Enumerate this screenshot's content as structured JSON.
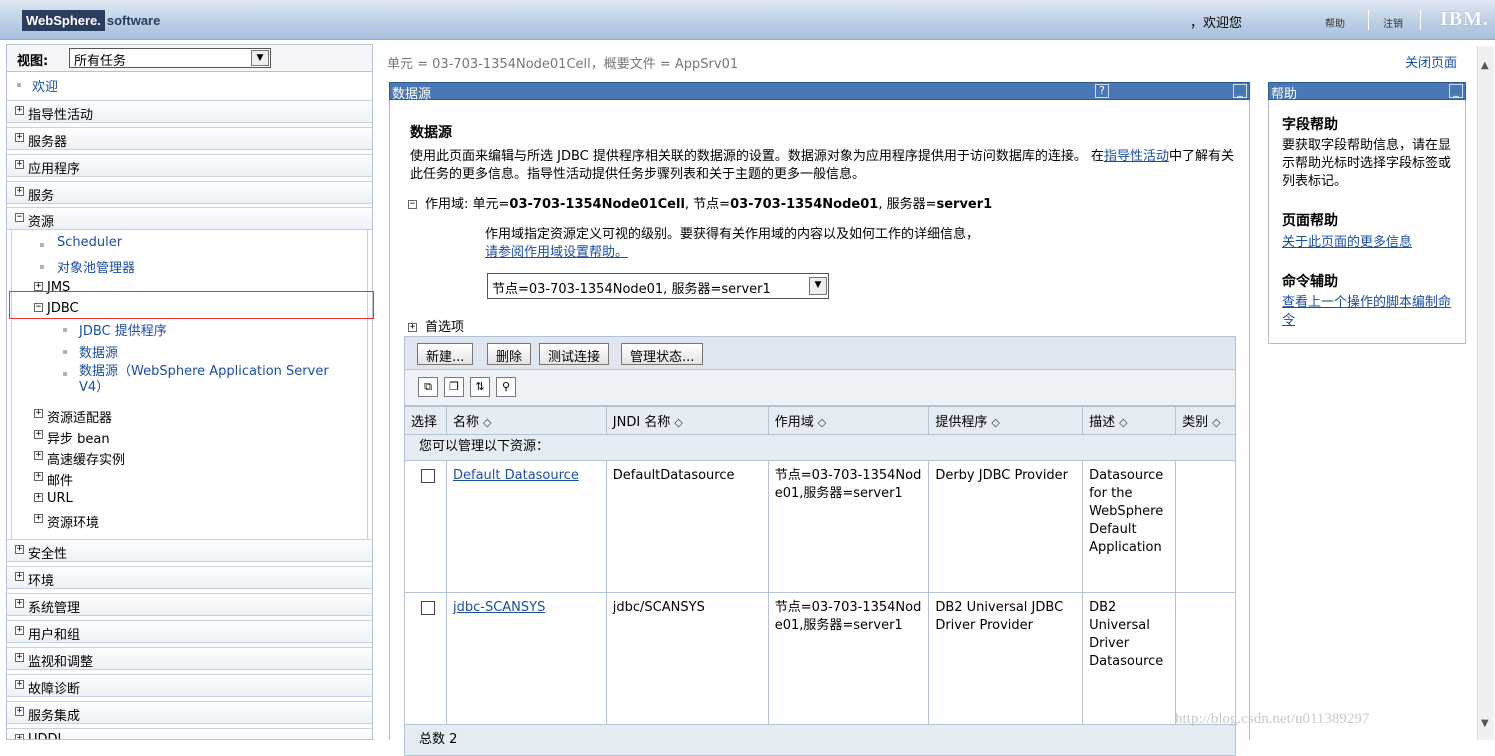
{
  "banner": {
    "logo_brand": "WebSphere.",
    "logo_product": "software",
    "welcome": "，欢迎您",
    "help": "帮助",
    "logout": "注销",
    "ibm": "IBM."
  },
  "nav": {
    "view_label": "视图:",
    "view_value": "所有任务",
    "welcome_item": "欢迎",
    "top_items": [
      "指导性活动",
      "服务器",
      "应用程序",
      "服务",
      "资源"
    ],
    "resources": {
      "scheduler": "Scheduler",
      "object_pool": "对象池管理器",
      "jms": "JMS",
      "jdbc": "JDBC",
      "jdbc_provider": "JDBC 提供程序",
      "datasource": "数据源",
      "datasource_v4": "数据源（WebSphere Application Server V4）",
      "sub_items": [
        "资源适配器",
        "异步 bean",
        "高速缓存实例",
        "邮件",
        "URL",
        "资源环境"
      ]
    },
    "bottom_items": [
      "安全性",
      "环境",
      "系统管理",
      "用户和组",
      "监视和调整",
      "故障诊断",
      "服务集成",
      "UDDI"
    ]
  },
  "breadcrumb": "单元 = 03-703-1354Node01Cell，概要文件 = AppSrv01",
  "close_page": "关闭页面",
  "main_panel": {
    "title_bar": "数据源",
    "help_btn": "?",
    "min_btn": "_",
    "heading": "数据源",
    "desc_1": "使用此页面来编辑与所选 JDBC 提供程序相关联的数据源的设置。数据源对象为应用程序提供用于访问数据库的连接。 在",
    "desc_link": "指导性活动",
    "desc_2": "中了解有关此任务的更多信息。指导性活动提供任务步骤列表和关于主题的更多一般信息。",
    "scope_prefix": "作用域: 单元=",
    "scope_cell": "03-703-1354Node01Cell",
    "scope_mid1": ", 节点=",
    "scope_node": "03-703-1354Node01",
    "scope_mid2": ", 服务器=",
    "scope_server": "server1",
    "scope_desc": "作用域指定资源定义可视的级别。要获得有关作用域的内容以及如何工作的详细信息，",
    "scope_help_link": "请参阅作用域设置帮助。",
    "scope_select": "节点=03-703-1354Node01, 服务器=server1",
    "preferences": "首选项",
    "buttons": [
      "新建...",
      "删除",
      "测试连接",
      "管理状态..."
    ],
    "table": {
      "headers": [
        "选择",
        "名称",
        "JNDI 名称",
        "作用域",
        "提供程序",
        "描述",
        "类别"
      ],
      "manage_text": "您可以管理以下资源：",
      "rows": [
        {
          "name": "Default Datasource",
          "jndi": "DefaultDatasource",
          "scope": "节点=03-703-1354Node01,服务器=server1",
          "provider": "Derby JDBC Provider",
          "desc": "Datasource for the WebSphere Default Application",
          "category": ""
        },
        {
          "name": "jdbc-SCANSYS",
          "jndi": "jdbc/SCANSYS",
          "scope": "节点=03-703-1354Node01,服务器=server1",
          "provider": "DB2 Universal JDBC Driver Provider",
          "desc": "DB2 Universal Driver Datasource",
          "category": ""
        }
      ],
      "total": "总数 2"
    }
  },
  "help_panel": {
    "title_bar": "帮助",
    "field_help_title": "字段帮助",
    "field_help_text": "要获取字段帮助信息，请在显示帮助光标时选择字段标签或列表标记。",
    "page_help_title": "页面帮助",
    "page_help_link": "关于此页面的更多信息",
    "command_title": "命令辅助",
    "command_link": "查看上一个操作的脚本编制命令"
  },
  "watermark": "http://blog.csdn.net/u011389297"
}
